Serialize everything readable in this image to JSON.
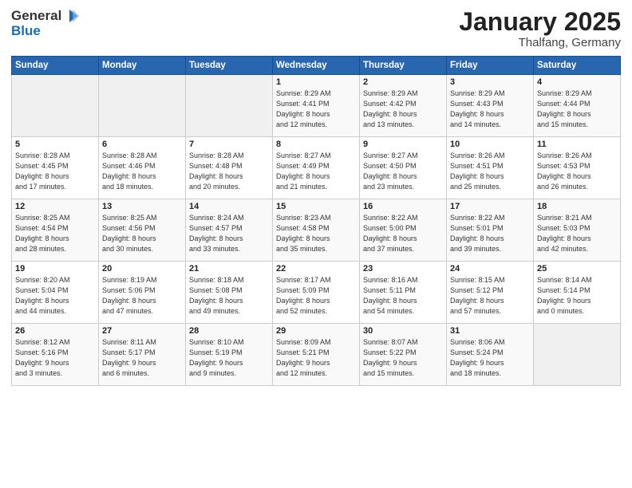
{
  "logo": {
    "general": "General",
    "blue": "Blue"
  },
  "header": {
    "month": "January 2025",
    "location": "Thalfang, Germany"
  },
  "weekdays": [
    "Sunday",
    "Monday",
    "Tuesday",
    "Wednesday",
    "Thursday",
    "Friday",
    "Saturday"
  ],
  "weeks": [
    [
      {
        "day": "",
        "info": ""
      },
      {
        "day": "",
        "info": ""
      },
      {
        "day": "",
        "info": ""
      },
      {
        "day": "1",
        "info": "Sunrise: 8:29 AM\nSunset: 4:41 PM\nDaylight: 8 hours\nand 12 minutes."
      },
      {
        "day": "2",
        "info": "Sunrise: 8:29 AM\nSunset: 4:42 PM\nDaylight: 8 hours\nand 13 minutes."
      },
      {
        "day": "3",
        "info": "Sunrise: 8:29 AM\nSunset: 4:43 PM\nDaylight: 8 hours\nand 14 minutes."
      },
      {
        "day": "4",
        "info": "Sunrise: 8:29 AM\nSunset: 4:44 PM\nDaylight: 8 hours\nand 15 minutes."
      }
    ],
    [
      {
        "day": "5",
        "info": "Sunrise: 8:28 AM\nSunset: 4:45 PM\nDaylight: 8 hours\nand 17 minutes."
      },
      {
        "day": "6",
        "info": "Sunrise: 8:28 AM\nSunset: 4:46 PM\nDaylight: 8 hours\nand 18 minutes."
      },
      {
        "day": "7",
        "info": "Sunrise: 8:28 AM\nSunset: 4:48 PM\nDaylight: 8 hours\nand 20 minutes."
      },
      {
        "day": "8",
        "info": "Sunrise: 8:27 AM\nSunset: 4:49 PM\nDaylight: 8 hours\nand 21 minutes."
      },
      {
        "day": "9",
        "info": "Sunrise: 8:27 AM\nSunset: 4:50 PM\nDaylight: 8 hours\nand 23 minutes."
      },
      {
        "day": "10",
        "info": "Sunrise: 8:26 AM\nSunset: 4:51 PM\nDaylight: 8 hours\nand 25 minutes."
      },
      {
        "day": "11",
        "info": "Sunrise: 8:26 AM\nSunset: 4:53 PM\nDaylight: 8 hours\nand 26 minutes."
      }
    ],
    [
      {
        "day": "12",
        "info": "Sunrise: 8:25 AM\nSunset: 4:54 PM\nDaylight: 8 hours\nand 28 minutes."
      },
      {
        "day": "13",
        "info": "Sunrise: 8:25 AM\nSunset: 4:56 PM\nDaylight: 8 hours\nand 30 minutes."
      },
      {
        "day": "14",
        "info": "Sunrise: 8:24 AM\nSunset: 4:57 PM\nDaylight: 8 hours\nand 33 minutes."
      },
      {
        "day": "15",
        "info": "Sunrise: 8:23 AM\nSunset: 4:58 PM\nDaylight: 8 hours\nand 35 minutes."
      },
      {
        "day": "16",
        "info": "Sunrise: 8:22 AM\nSunset: 5:00 PM\nDaylight: 8 hours\nand 37 minutes."
      },
      {
        "day": "17",
        "info": "Sunrise: 8:22 AM\nSunset: 5:01 PM\nDaylight: 8 hours\nand 39 minutes."
      },
      {
        "day": "18",
        "info": "Sunrise: 8:21 AM\nSunset: 5:03 PM\nDaylight: 8 hours\nand 42 minutes."
      }
    ],
    [
      {
        "day": "19",
        "info": "Sunrise: 8:20 AM\nSunset: 5:04 PM\nDaylight: 8 hours\nand 44 minutes."
      },
      {
        "day": "20",
        "info": "Sunrise: 8:19 AM\nSunset: 5:06 PM\nDaylight: 8 hours\nand 47 minutes."
      },
      {
        "day": "21",
        "info": "Sunrise: 8:18 AM\nSunset: 5:08 PM\nDaylight: 8 hours\nand 49 minutes."
      },
      {
        "day": "22",
        "info": "Sunrise: 8:17 AM\nSunset: 5:09 PM\nDaylight: 8 hours\nand 52 minutes."
      },
      {
        "day": "23",
        "info": "Sunrise: 8:16 AM\nSunset: 5:11 PM\nDaylight: 8 hours\nand 54 minutes."
      },
      {
        "day": "24",
        "info": "Sunrise: 8:15 AM\nSunset: 5:12 PM\nDaylight: 8 hours\nand 57 minutes."
      },
      {
        "day": "25",
        "info": "Sunrise: 8:14 AM\nSunset: 5:14 PM\nDaylight: 9 hours\nand 0 minutes."
      }
    ],
    [
      {
        "day": "26",
        "info": "Sunrise: 8:12 AM\nSunset: 5:16 PM\nDaylight: 9 hours\nand 3 minutes."
      },
      {
        "day": "27",
        "info": "Sunrise: 8:11 AM\nSunset: 5:17 PM\nDaylight: 9 hours\nand 6 minutes."
      },
      {
        "day": "28",
        "info": "Sunrise: 8:10 AM\nSunset: 5:19 PM\nDaylight: 9 hours\nand 9 minutes."
      },
      {
        "day": "29",
        "info": "Sunrise: 8:09 AM\nSunset: 5:21 PM\nDaylight: 9 hours\nand 12 minutes."
      },
      {
        "day": "30",
        "info": "Sunrise: 8:07 AM\nSunset: 5:22 PM\nDaylight: 9 hours\nand 15 minutes."
      },
      {
        "day": "31",
        "info": "Sunrise: 8:06 AM\nSunset: 5:24 PM\nDaylight: 9 hours\nand 18 minutes."
      },
      {
        "day": "",
        "info": ""
      }
    ]
  ]
}
